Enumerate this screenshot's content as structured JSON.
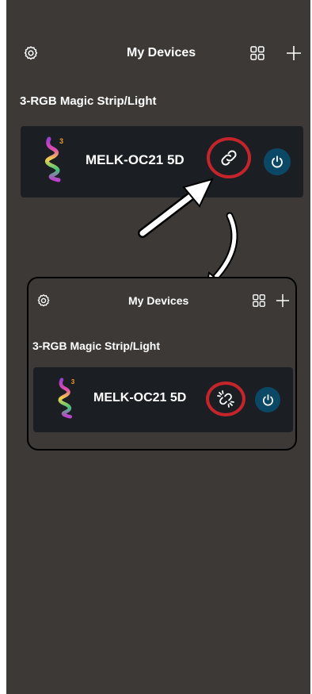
{
  "header": {
    "title": "My Devices"
  },
  "group": {
    "name": "3-RGB Magic Strip/Light"
  },
  "device": {
    "name": "MELK-OC21 5D",
    "badge": "3"
  },
  "icons": {
    "settings": "settings-gear-icon",
    "grid": "grid-view-icon",
    "add": "plus-icon",
    "link": "link-icon",
    "unlink": "broken-link-icon",
    "power": "power-icon"
  },
  "colors": {
    "background": "#3c3936",
    "card": "#1b1f24",
    "highlight_ring": "#c6242b",
    "power_button": "#0b4866"
  },
  "inset": {
    "header": {
      "title": "My Devices"
    },
    "group": {
      "name": "3-RGB Magic Strip/Light"
    },
    "device": {
      "name": "MELK-OC21 5D",
      "badge": "3"
    }
  }
}
